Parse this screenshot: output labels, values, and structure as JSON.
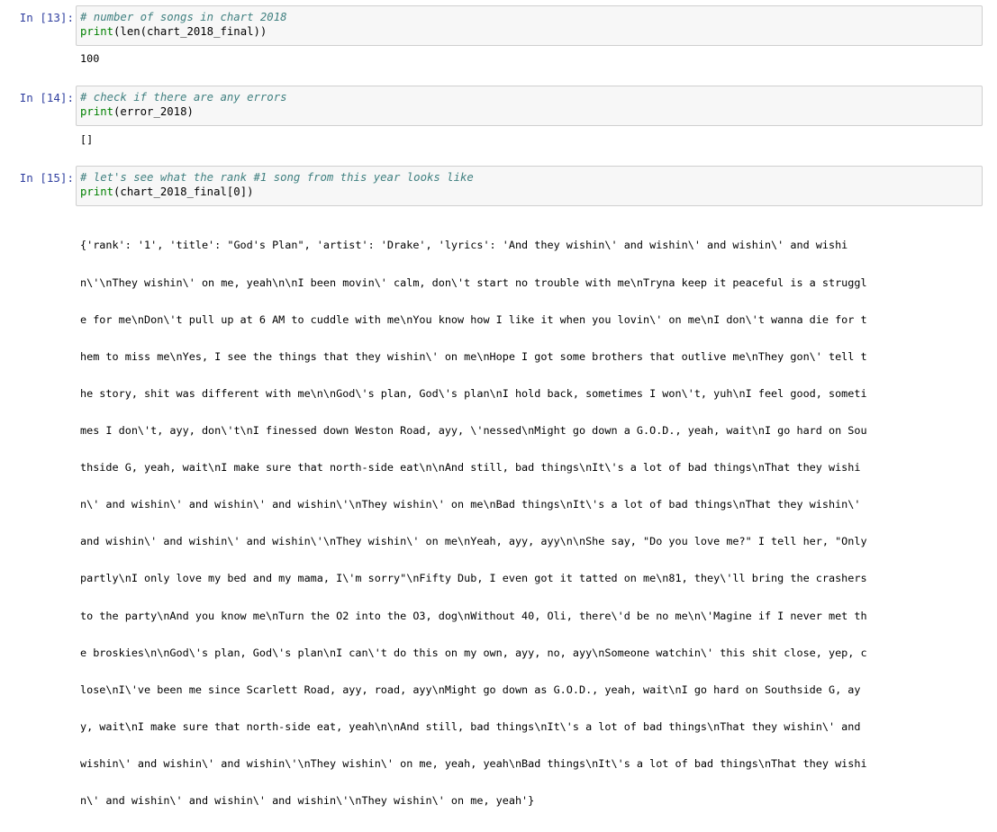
{
  "cells": [
    {
      "prompt": "In [13]:",
      "comment": "# number of songs in chart 2018",
      "code_builtin": "print",
      "code_rest": "(len(chart_2018_final))",
      "code_inner_builtin": "len",
      "output": "100"
    },
    {
      "prompt": "In [14]:",
      "comment": "# check if there are any errors",
      "code_builtin": "print",
      "code_rest": "(error_2018)",
      "output": "[]"
    },
    {
      "prompt": "In [15]:",
      "comment": "# let's see what the rank #1 song from this year looks like",
      "code_builtin": "print",
      "code_rest": "(chart_2018_final[0])",
      "output_lines": [
        "{'rank': '1', 'title': \"God's Plan\", 'artist': 'Drake', 'lyrics': 'And they wishin\\' and wishin\\' and wishin\\' and wishi",
        "n\\'\\nThey wishin\\' on me, yeah\\n\\nI been movin\\' calm, don\\'t start no trouble with me\\nTryna keep it peaceful is a struggl",
        "e for me\\nDon\\'t pull up at 6 AM to cuddle with me\\nYou know how I like it when you lovin\\' on me\\nI don\\'t wanna die for t",
        "hem to miss me\\nYes, I see the things that they wishin\\' on me\\nHope I got some brothers that outlive me\\nThey gon\\' tell t",
        "he story, shit was different with me\\n\\nGod\\'s plan, God\\'s plan\\nI hold back, sometimes I won\\'t, yuh\\nI feel good, someti",
        "mes I don\\'t, ayy, don\\'t\\nI finessed down Weston Road, ayy, \\'nessed\\nMight go down a G.O.D., yeah, wait\\nI go hard on Sou",
        "thside G, yeah, wait\\nI make sure that north-side eat\\n\\nAnd still, bad things\\nIt\\'s a lot of bad things\\nThat they wishi",
        "n\\' and wishin\\' and wishin\\' and wishin\\'\\nThey wishin\\' on me\\nBad things\\nIt\\'s a lot of bad things\\nThat they wishin\\'",
        "and wishin\\' and wishin\\' and wishin\\'\\nThey wishin\\' on me\\nYeah, ayy, ayy\\n\\nShe say, \"Do you love me?\" I tell her, \"Only",
        "partly\\nI only love my bed and my mama, I\\'m sorry\"\\nFifty Dub, I even got it tatted on me\\n81, they\\'ll bring the crashers",
        "to the party\\nAnd you know me\\nTurn the O2 into the O3, dog\\nWithout 40, Oli, there\\'d be no me\\n\\'Magine if I never met th",
        "e broskies\\n\\nGod\\'s plan, God\\'s plan\\nI can\\'t do this on my own, ayy, no, ayy\\nSomeone watchin\\' this shit close, yep, c",
        "lose\\nI\\'ve been me since Scarlett Road, ayy, road, ayy\\nMight go down as G.O.D., yeah, wait\\nI go hard on Southside G, ay",
        "y, wait\\nI make sure that north-side eat, yeah\\n\\nAnd still, bad things\\nIt\\'s a lot of bad things\\nThat they wishin\\' and",
        "wishin\\' and wishin\\' and wishin\\'\\nThey wishin\\' on me, yeah, yeah\\nBad things\\nIt\\'s a lot of bad things\\nThat they wishi",
        "n\\' and wishin\\' and wishin\\' and wishin\\'\\nThey wishin\\' on me, yeah'}"
      ]
    }
  ]
}
